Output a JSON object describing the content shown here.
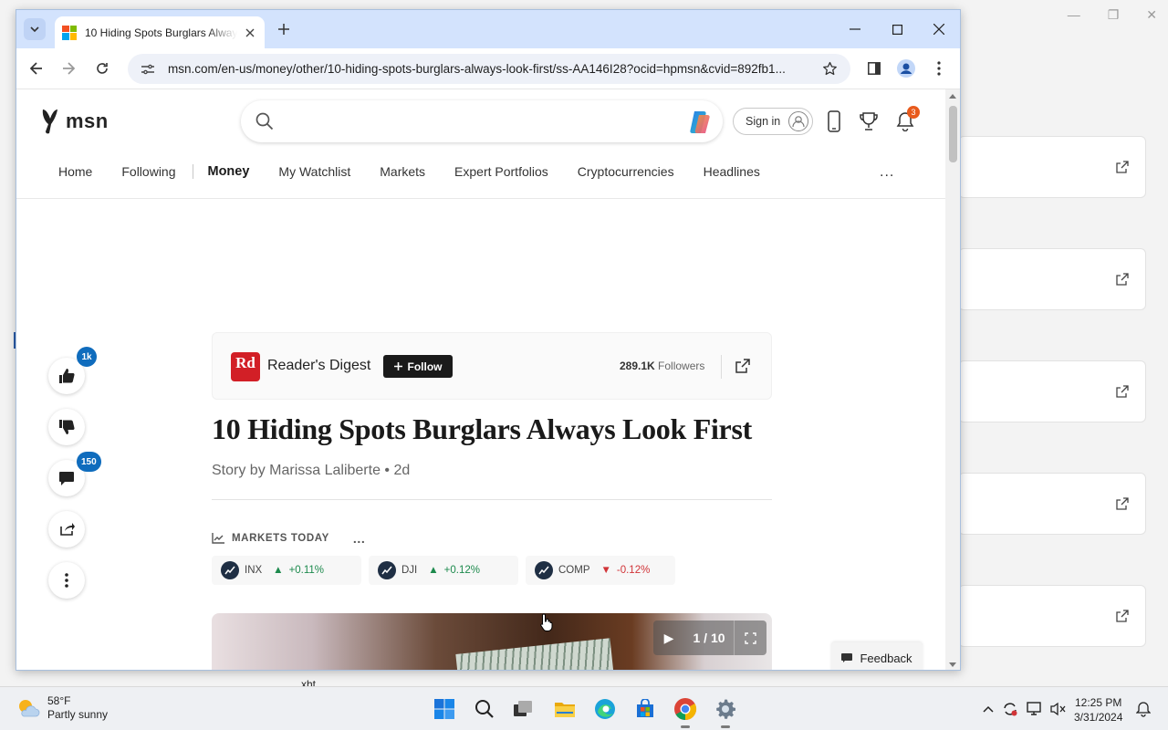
{
  "browser": {
    "tab_title": "10 Hiding Spots Burglars Always Look First",
    "url": "msn.com/en-us/money/other/10-hiding-spots-burglars-always-look-first/ss-AA146I28?ocid=hpmsn&cvid=892fb1..."
  },
  "msn": {
    "logo_text": "msn",
    "signin_label": "Sign in",
    "notification_count": "3",
    "nav": {
      "items": [
        "Home",
        "Following",
        "Money",
        "My Watchlist",
        "Markets",
        "Expert Portfolios",
        "Cryptocurrencies",
        "Headlines"
      ],
      "active": "Money",
      "more": "..."
    }
  },
  "rail": {
    "like_count": "1k",
    "comment_count": "150"
  },
  "article": {
    "publisher": {
      "logo_text": "Rd",
      "name": "Reader's Digest",
      "follow_label": "Follow",
      "followers_count": "289.1K",
      "followers_label": "Followers"
    },
    "title": "10 Hiding Spots Burglars Always Look First",
    "byline": "Story by Marissa Laliberte • 2d",
    "markets_today_label": "MARKETS TODAY",
    "markets_more": "...",
    "tickers": [
      {
        "name": "INX",
        "change": "+0.11%",
        "direction": "up"
      },
      {
        "name": "DJI",
        "change": "+0.12%",
        "direction": "up"
      },
      {
        "name": "COMP",
        "change": "-0.12%",
        "direction": "down"
      }
    ],
    "slideshow_counter": "1 / 10",
    "feedback_label": "Feedback"
  },
  "desktop": {
    "partial_text": "xht"
  },
  "taskbar": {
    "weather_temp": "58°F",
    "weather_desc": "Partly sunny",
    "time": "12:25 PM",
    "date": "3/31/2024"
  },
  "colors": {
    "accent_blue": "#0f6cbd",
    "up_green": "#1d8a4d",
    "down_red": "#d13438",
    "tab_strip": "#d3e3fd",
    "readers_digest_red": "#d21f26"
  }
}
